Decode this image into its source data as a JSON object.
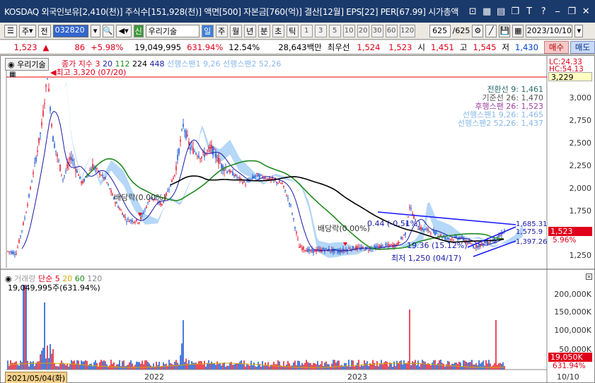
{
  "titlebar": {
    "text": "KOSDAQ 외국인보유[2,410(천)] 주식수[151,928(천)] 액면[500] 자본금[760(억)] 결산[12월] EPS[22] PER[67.99] 시가총액",
    "icons": [
      "layout-icon",
      "grid-icon",
      "chart-icon",
      "copy-icon",
      "text-icon",
      "help-icon",
      "minimize-icon",
      "restore-icon",
      "close-icon"
    ]
  },
  "toolbar": {
    "type_label": "주",
    "prev_label": "전",
    "code": "032820",
    "new_badge": "신",
    "stock_name": "우리기술",
    "periods": [
      "일",
      "주",
      "월",
      "년",
      "분",
      "초",
      "틱"
    ],
    "active_period": "일",
    "numbers": [
      "1",
      "3",
      "5",
      "10",
      "20",
      "30",
      "60",
      "120"
    ],
    "count": "625",
    "total": "/625",
    "date": "2023/10/10"
  },
  "quote": {
    "price": "1,523",
    "arrow": "▲",
    "change": "86",
    "change_pct": "+5.98%",
    "volume": "19,049,995",
    "volume_pct": "631.94%",
    "turnover": "12.54%",
    "amount": "28,643백만",
    "pref_label": "최우선",
    "pref1": "1,524",
    "pref2": "1,523",
    "open_label": "시",
    "open": "1,451",
    "high_label": "고",
    "high": "1,545",
    "low_label": "저",
    "low": "1,430",
    "buy_label": "매수",
    "sell_label": "매도"
  },
  "chart": {
    "stock_tab": "우리기술",
    "legend_price": "종가 지수 3",
    "ma": [
      "20",
      "112",
      "224",
      "448"
    ],
    "ichimoku1": "선행스팬1 9,26",
    "ichimoku2": "선행스팬2 52,26",
    "high_note": "최고 3,320 (07/20)",
    "lc": "LC:24.33",
    "hc": "HC:54.13",
    "top_price": "3,229",
    "right_legend": [
      "전환선 9: 1,461",
      "기준선 26: 1,470",
      "후행스팬 26: 1,523",
      "선행스팬1 9,26: 1,465",
      "선행스팬2 52,26: 1,437"
    ],
    "price_axis": [
      "3,000",
      "2,750",
      "2,500",
      "2,250",
      "2,000",
      "1,750",
      "1,250"
    ],
    "current_price_tag": "1,523",
    "current_pct_tag": "5.96%",
    "annotations": {
      "div1": "배당락(0.00%)",
      "div2": "배당락(0.00%)",
      "pct1": "0.44 (-0.51%)",
      "pct2": "19.36 (15.12%)",
      "low_note": "최저 1,250 (04/17)",
      "line_val1": "1,685.31",
      "line_val2": "1,575.9",
      "line_val3": "1,397.26"
    },
    "x_labels": [
      "2021/05/04(화)",
      "2022",
      "2023",
      "10/10"
    ]
  },
  "volume": {
    "legend_label": "거래량",
    "legend_type": "단순 5",
    "ma": [
      "20",
      "60",
      "120"
    ],
    "current": "19,049,995주(631.94%)",
    "axis": [
      "200,000K",
      "150,000K",
      "100,000K",
      "50,000K"
    ],
    "tag_value": "19,050K",
    "tag_pct": "631.94%"
  },
  "colors": {
    "up": "#e0001a",
    "down": "#0044cc",
    "ma20": "#1a1aa8",
    "ma112": "#1f8a1f",
    "ma224": "#000000",
    "cloud": "#9ccaf5",
    "titlebar": "#1a3a6b"
  }
}
